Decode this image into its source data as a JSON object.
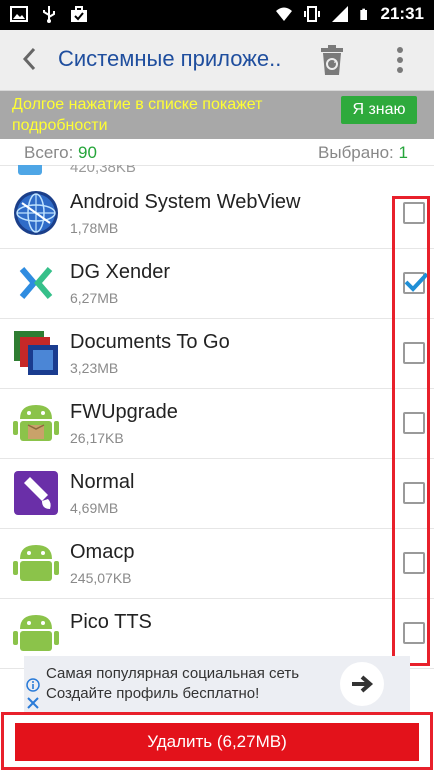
{
  "status_bar": {
    "time": "21:31",
    "left_icons": [
      "gallery-icon",
      "usb-icon",
      "briefcase-check-icon"
    ],
    "right_icons": [
      "wifi-icon",
      "vibrate-icon",
      "signal-icon",
      "battery-icon"
    ]
  },
  "app_bar": {
    "title": "Системные приложе.."
  },
  "hint": {
    "text": "Долгое нажатие в списке покажет подробности",
    "ok_label": "Я знаю"
  },
  "counts": {
    "total_label": "Всего:",
    "total_value": "90",
    "selected_label": "Выбрано:",
    "selected_value": "1"
  },
  "partial_row": {
    "size": "420,38KB"
  },
  "apps": [
    {
      "name": "Android System WebView",
      "size": "1,78MB",
      "checked": false,
      "icon": "webview-icon"
    },
    {
      "name": "DG Xender",
      "size": "6,27MB",
      "checked": true,
      "icon": "xender-icon"
    },
    {
      "name": "Documents To Go",
      "size": "3,23MB",
      "checked": false,
      "icon": "documents-to-go-icon"
    },
    {
      "name": "FWUpgrade",
      "size": "26,17KB",
      "checked": false,
      "icon": "android-box-icon"
    },
    {
      "name": "Normal",
      "size": "4,69MB",
      "checked": false,
      "icon": "theme-paint-icon"
    },
    {
      "name": "Omacp",
      "size": "245,07KB",
      "checked": false,
      "icon": "android-icon"
    },
    {
      "name": "Pico TTS",
      "size": "",
      "checked": false,
      "icon": "android-icon"
    }
  ],
  "ad": {
    "line1": "Самая популярная социальная сеть",
    "line2": "Создайте профиль бесплатно!"
  },
  "delete_button": {
    "label": "Удалить (6,27MB)"
  },
  "colors": {
    "title_blue": "#1f4e9e",
    "hint_yellow": "#ffff33",
    "ok_green": "#2eaa3c",
    "delete_red": "#e3121b",
    "highlight_red": "#e8202b"
  }
}
